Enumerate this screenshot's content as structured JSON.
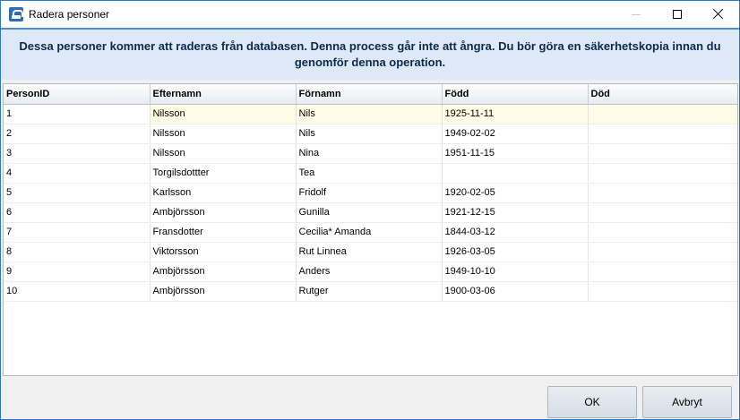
{
  "window": {
    "title": "Radera personer",
    "icon": "app-icon"
  },
  "notice": {
    "text": "Dessa personer kommer att raderas från databasen. Denna process går inte att ångra. Du bör göra en säkerhetskopia innan du genomför denna operation."
  },
  "table": {
    "columns": [
      "PersonID",
      "Efternamn",
      "Förnamn",
      "Född",
      "Död"
    ],
    "rows": [
      [
        "1",
        "Nilsson",
        "Nils",
        "1925-11-11",
        ""
      ],
      [
        "2",
        "Nilsson",
        "Nils",
        "1949-02-02",
        ""
      ],
      [
        "3",
        "Nilsson",
        "Nina",
        "1951-11-15",
        ""
      ],
      [
        "4",
        "Torgilsdottter",
        "Tea",
        "",
        ""
      ],
      [
        "5",
        "Karlsson",
        "Fridolf",
        "1920-02-05",
        ""
      ],
      [
        "6",
        "Ambjörsson",
        "Gunilla",
        "1921-12-15",
        ""
      ],
      [
        "7",
        "Fransdotter",
        "Cecilia* Amanda",
        "1844-03-12",
        ""
      ],
      [
        "8",
        "Viktorsson",
        "Rut Linnea",
        "1926-03-05",
        ""
      ],
      [
        "9",
        "Ambjörsson",
        "Anders",
        "1949-10-10",
        ""
      ],
      [
        "10",
        "Ambjörsson",
        "Rutger",
        "1900-03-06",
        ""
      ]
    ]
  },
  "buttons": {
    "ok": "OK",
    "cancel": "Avbryt"
  },
  "colors": {
    "accent": "#2b78c5",
    "notice_bg": "#dde9f6",
    "selected_row": "#fffde6"
  }
}
